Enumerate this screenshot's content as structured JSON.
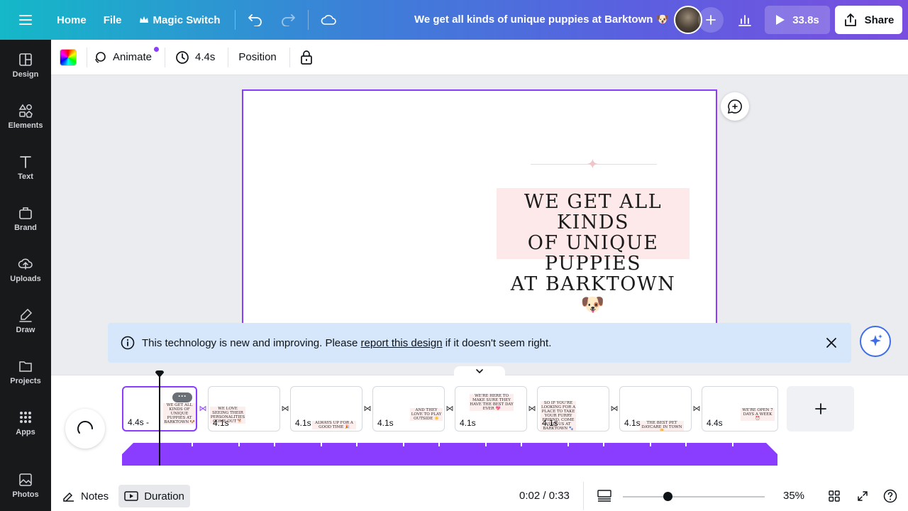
{
  "topbar": {
    "home_label": "Home",
    "file_label": "File",
    "magic_switch_label": "Magic Switch",
    "doc_title": "We get all kinds of unique puppies at Barktown 🐶",
    "play_label": "33.8s",
    "share_label": "Share"
  },
  "sidebar": {
    "items": [
      {
        "label": "Design",
        "icon": "design-icon"
      },
      {
        "label": "Elements",
        "icon": "elements-icon"
      },
      {
        "label": "Text",
        "icon": "text-icon"
      },
      {
        "label": "Brand",
        "icon": "brand-icon"
      },
      {
        "label": "Uploads",
        "icon": "uploads-icon"
      },
      {
        "label": "Draw",
        "icon": "draw-icon"
      },
      {
        "label": "Projects",
        "icon": "projects-icon"
      },
      {
        "label": "Apps",
        "icon": "apps-icon"
      },
      {
        "label": "Photos",
        "icon": "photos-icon"
      }
    ]
  },
  "context_toolbar": {
    "animate_label": "Animate",
    "duration_label": "4.4s",
    "position_label": "Position"
  },
  "canvas": {
    "headline_line1": "WE GET ALL KINDS",
    "headline_line2": "OF UNIQUE PUPPIES",
    "headline_line3": "AT BARKTOWN 🐶"
  },
  "notice": {
    "text_before": "This technology is new and improving. Please",
    "link_text": "report this design",
    "text_after": "if it doesn't seem right."
  },
  "timeline": {
    "clips": [
      {
        "duration": "4.4s -",
        "mini_text": "WE GET ALL KINDS OF UNIQUE PUPPIES AT BARKTOWN 🐶"
      },
      {
        "duration": "4.1s",
        "mini_text": "WE LOVE SEEING THEIR PERSONALITIES COME OUT 🐕"
      },
      {
        "duration": "4.1s",
        "mini_text": "ALWAYS UP FOR A GOOD TIME 🎉"
      },
      {
        "duration": "4.1s",
        "mini_text": "AND THEY LOVE TO PLAY OUTSIDE ☀️"
      },
      {
        "duration": "4.1s",
        "mini_text": "WE'RE HERE TO MAKE SURE THEY HAVE THE BEST DAY EVER 💖"
      },
      {
        "duration": "4.1s",
        "mini_text": "SO IF YOU'RE LOOKING FOR A PLACE TO TAKE YOUR FURRY FRIEND, COME VISIT US AT BARKTOWN 🐾"
      },
      {
        "duration": "4.1s",
        "mini_text": "THE BEST PET DAYCARE IN TOWN 🏆"
      },
      {
        "duration": "4.4s",
        "mini_text": "WE'RE OPEN 7 DAYS A WEEK ⏰"
      }
    ]
  },
  "footer": {
    "notes_label": "Notes",
    "duration_label": "Duration",
    "time_readout": "0:02 / 0:33",
    "zoom_label": "35%",
    "zoom_fraction": 0.31
  },
  "colors": {
    "accent": "#8b3dff",
    "sidebar_bg": "#18191b",
    "notice_bg": "#d6e6fb",
    "headline_bg": "#fde9e9"
  }
}
